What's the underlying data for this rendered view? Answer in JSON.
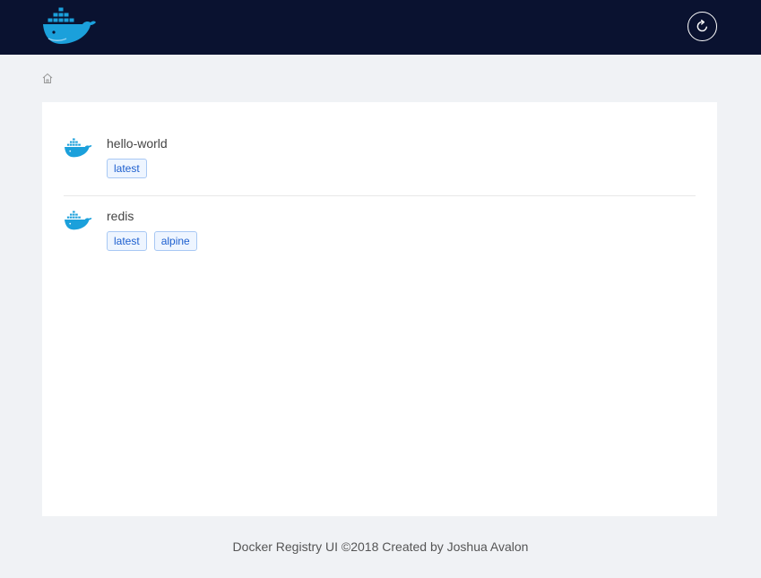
{
  "header": {
    "logo_icon": "docker-whale-icon",
    "refresh_icon": "refresh-icon",
    "background": "#0a1230"
  },
  "breadcrumb": {
    "home_icon": "home-icon"
  },
  "repositories": [
    {
      "name": "hello-world",
      "icon": "docker-whale-icon",
      "tags": [
        "latest"
      ]
    },
    {
      "name": "redis",
      "icon": "docker-whale-icon",
      "tags": [
        "latest",
        "alpine"
      ]
    }
  ],
  "footer": {
    "text": "Docker Registry UI ©2018 Created by Joshua Avalon"
  },
  "colors": {
    "accent": "#1d5fcf",
    "whale": "#1ba0db",
    "page_background": "#f0f2f5"
  }
}
